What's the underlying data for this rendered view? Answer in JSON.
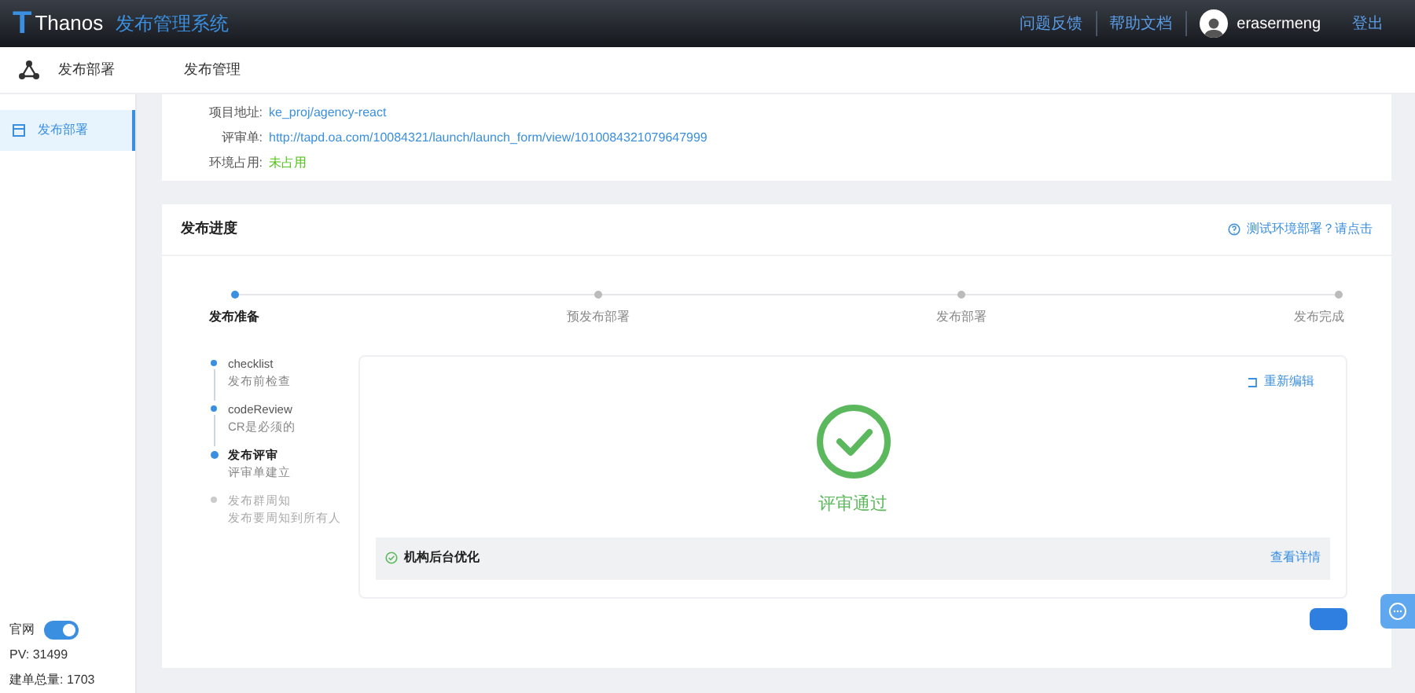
{
  "header": {
    "logo_letter": "T",
    "app_name": "Thanos",
    "system_title": "发布管理系统",
    "links": [
      "问题反馈",
      "帮助文档"
    ],
    "username": "erasermeng",
    "logout": "登出"
  },
  "subheader": {
    "module": "发布部署",
    "breadcrumb": "发布管理"
  },
  "sidebar": {
    "items": [
      {
        "label": "发布部署",
        "selected": true
      }
    ],
    "toggle": {
      "label": "官网",
      "on": true
    },
    "stats": [
      "PV: 31499",
      "建单总量: 1703"
    ]
  },
  "info": {
    "rows": [
      {
        "label": "项目地址:",
        "value": "ke_proj/agency-react",
        "kind": "link"
      },
      {
        "label": "评审单:",
        "value": "http://tapd.oa.com/10084321/launch/launch_form/view/1010084321079647999",
        "kind": "link"
      },
      {
        "label": "环境占用:",
        "value": "未占用",
        "kind": "status"
      }
    ]
  },
  "progress": {
    "title": "发布进度",
    "help_link": "测试环境部署？请点击",
    "steps": [
      {
        "label": "发布准备",
        "selected": true
      },
      {
        "label": "预发布部署",
        "selected": false
      },
      {
        "label": "发布部署",
        "selected": false
      },
      {
        "label": "发布完成",
        "selected": false
      }
    ],
    "substeps": [
      {
        "title": "checklist",
        "desc": "发布前检查",
        "kind": "done"
      },
      {
        "title": "codeReview",
        "desc": "CR是必须的",
        "kind": "done"
      },
      {
        "title": "发布评审",
        "desc": "评审单建立",
        "kind": "current"
      },
      {
        "title": "发布群周知",
        "desc": "发布要周知到所有人",
        "kind": "pending"
      }
    ],
    "result": {
      "reedit": "重新编辑",
      "status": "评审通过",
      "item": "机构后台优化",
      "detail_link": "查看详情"
    }
  }
}
